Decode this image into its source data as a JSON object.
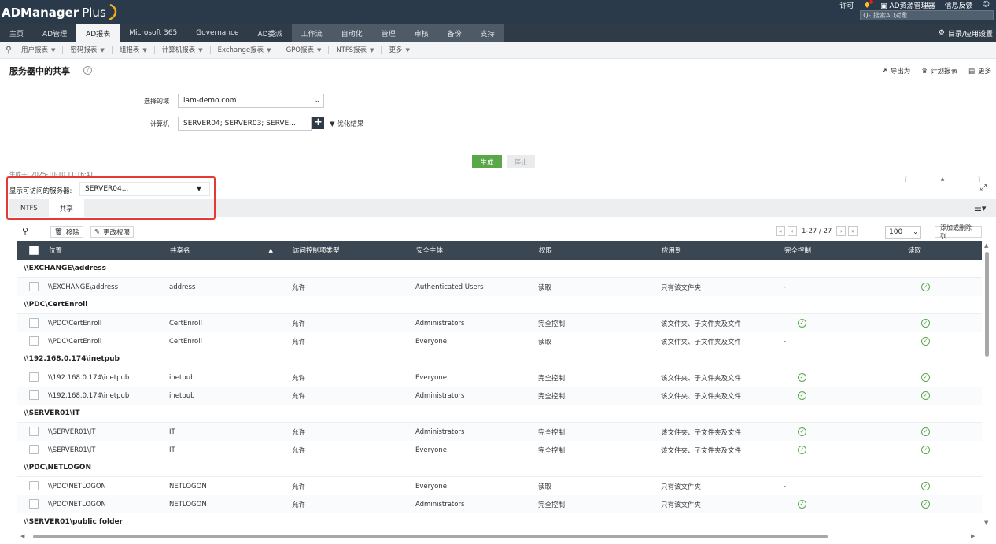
{
  "header": {
    "logo": "ADManager",
    "logo_plus": "Plus",
    "license": "许可",
    "ad_explorer": "AD资源管理器",
    "feedback": "信息反馈",
    "search_placeholder": "搜索AD对象"
  },
  "nav": {
    "tabs": [
      "主页",
      "AD管理",
      "AD报表",
      "Microsoft 365",
      "Governance",
      "AD委派",
      "工作流",
      "自动化",
      "管理",
      "审核",
      "备份",
      "支持"
    ],
    "active": "AD报表",
    "dir_settings": "目录/应用设置"
  },
  "subnav": {
    "items": [
      "用户报表",
      "密码报表",
      "组报表",
      "计算机报表",
      "Exchange报表",
      "GPO报表",
      "NTFS报表",
      "更多"
    ]
  },
  "page": {
    "title": "服务器中的共享",
    "export": "导出为",
    "schedule": "计划报表",
    "more": "更多"
  },
  "form": {
    "domain_label": "选择的域",
    "domain_value": "iam-demo.com",
    "computer_label": "计算机",
    "computer_value": "SERVER04; SERVER03; SERVE...",
    "filter_label": "优化结果",
    "generate": "生成",
    "stop": "停止",
    "generated_at": "生成于: 2025-10-10 11:16:41"
  },
  "server_filter": {
    "label": "显示可访问的服务器:",
    "value": "SERVER04..."
  },
  "tabs": [
    "NTFS",
    "共享"
  ],
  "active_tab": "共享",
  "toolbar": {
    "delete": "移除",
    "change_perm": "更改权限",
    "range": "1-27 / 27",
    "page_size": "100",
    "columns": "添加或删除列"
  },
  "table": {
    "headers": [
      "位置",
      "共享名",
      "访问控制项类型",
      "安全主体",
      "权限",
      "应用到",
      "完全控制",
      "读取"
    ],
    "groups": [
      {
        "title": "\\\\EXCHANGE\\address",
        "rows": [
          {
            "location": "\\\\EXCHANGE\\address",
            "share": "address",
            "ace": "允许",
            "principal": "Authenticated Users",
            "perm": "读取",
            "apply": "只有该文件夹",
            "full": "-",
            "read": "check"
          }
        ]
      },
      {
        "title": "\\\\PDC\\CertEnroll",
        "rows": [
          {
            "location": "\\\\PDC\\CertEnroll",
            "share": "CertEnroll",
            "ace": "允许",
            "principal": "Administrators",
            "perm": "完全控制",
            "apply": "该文件夹、子文件夹及文件",
            "full": "check",
            "read": "check"
          },
          {
            "location": "\\\\PDC\\CertEnroll",
            "share": "CertEnroll",
            "ace": "允许",
            "principal": "Everyone",
            "perm": "读取",
            "apply": "该文件夹、子文件夹及文件",
            "full": "-",
            "read": "check"
          }
        ]
      },
      {
        "title": "\\\\192.168.0.174\\inetpub",
        "rows": [
          {
            "location": "\\\\192.168.0.174\\inetpub",
            "share": "inetpub",
            "ace": "允许",
            "principal": "Everyone",
            "perm": "完全控制",
            "apply": "该文件夹、子文件夹及文件",
            "full": "check",
            "read": "check"
          },
          {
            "location": "\\\\192.168.0.174\\inetpub",
            "share": "inetpub",
            "ace": "允许",
            "principal": "Administrators",
            "perm": "完全控制",
            "apply": "该文件夹、子文件夹及文件",
            "full": "check",
            "read": "check"
          }
        ]
      },
      {
        "title": "\\\\SERVER01\\IT",
        "rows": [
          {
            "location": "\\\\SERVER01\\IT",
            "share": "IT",
            "ace": "允许",
            "principal": "Administrators",
            "perm": "完全控制",
            "apply": "该文件夹、子文件夹及文件",
            "full": "check",
            "read": "check"
          },
          {
            "location": "\\\\SERVER01\\IT",
            "share": "IT",
            "ace": "允许",
            "principal": "Everyone",
            "perm": "完全控制",
            "apply": "该文件夹、子文件夹及文件",
            "full": "check",
            "read": "check"
          }
        ]
      },
      {
        "title": "\\\\PDC\\NETLOGON",
        "rows": [
          {
            "location": "\\\\PDC\\NETLOGON",
            "share": "NETLOGON",
            "ace": "允许",
            "principal": "Everyone",
            "perm": "读取",
            "apply": "只有该文件夹",
            "full": "-",
            "read": "check"
          },
          {
            "location": "\\\\PDC\\NETLOGON",
            "share": "NETLOGON",
            "ace": "允许",
            "principal": "Administrators",
            "perm": "完全控制",
            "apply": "只有该文件夹",
            "full": "check",
            "read": "check"
          }
        ]
      },
      {
        "title": "\\\\SERVER01\\public folder",
        "rows": []
      }
    ]
  },
  "colors": {
    "header_bg": "#2b3a4a",
    "nav_bg": "#2f3c48",
    "accent_green": "#5aa74a",
    "highlight_red": "#e53935"
  }
}
